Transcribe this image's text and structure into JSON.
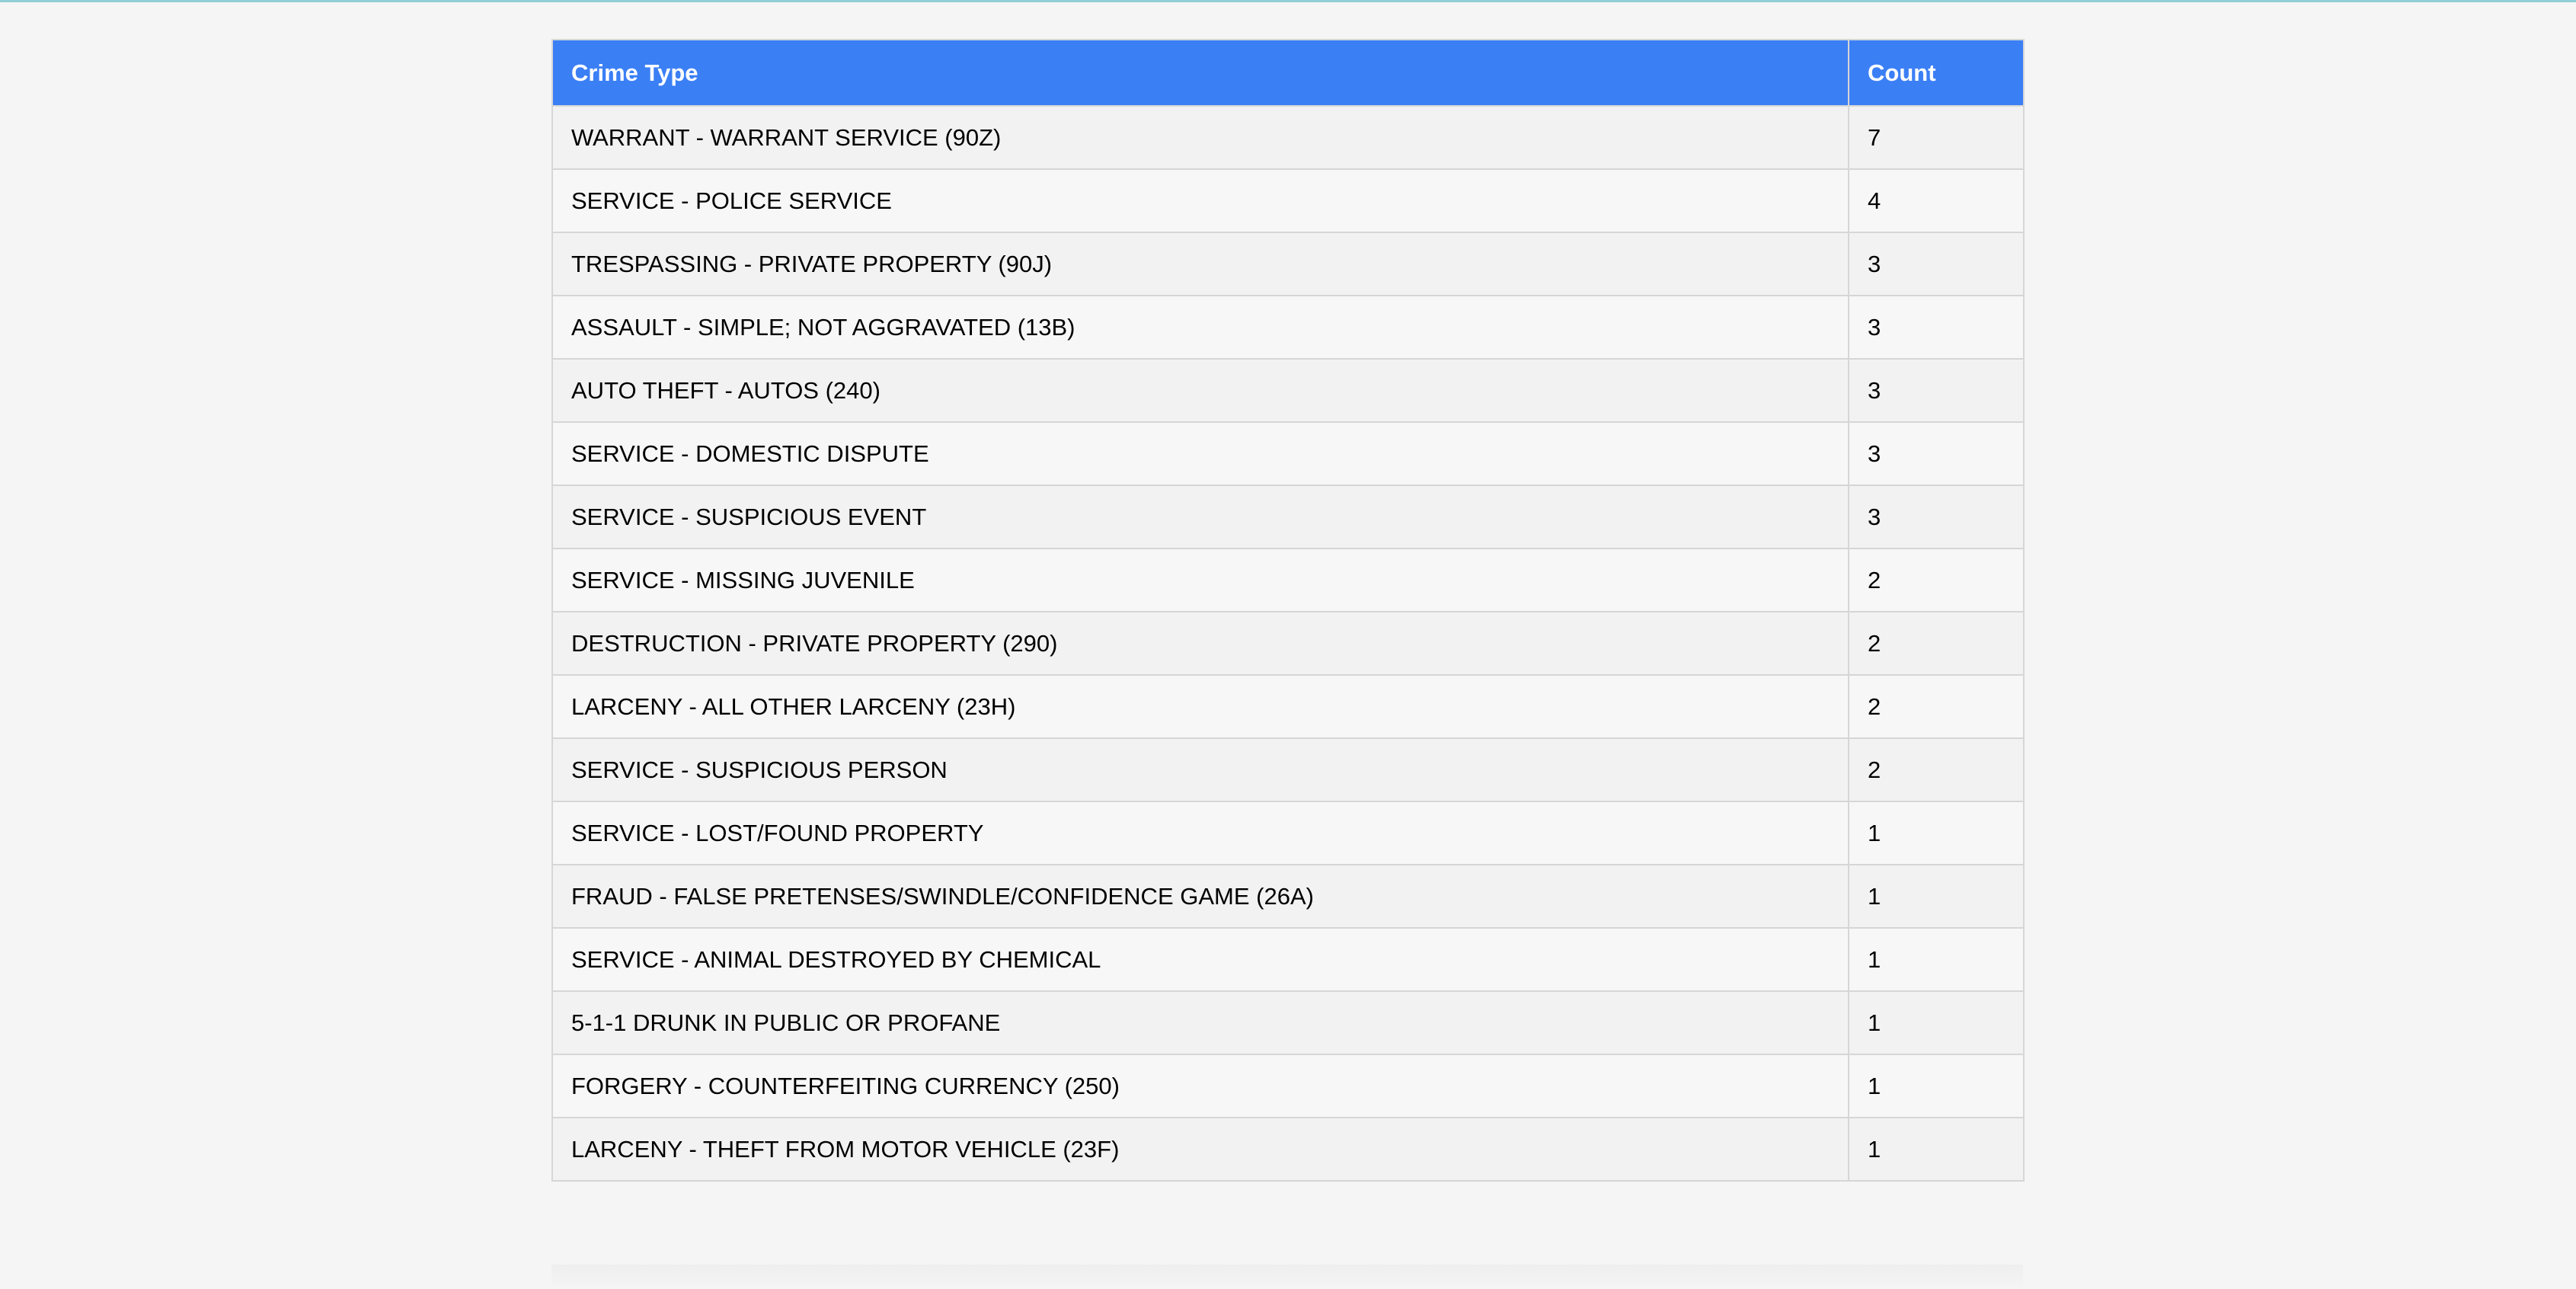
{
  "table": {
    "headers": {
      "crime_type": "Crime Type",
      "count": "Count"
    },
    "rows": [
      {
        "crime_type": "WARRANT - WARRANT SERVICE (90Z)",
        "count": "7"
      },
      {
        "crime_type": "SERVICE - POLICE SERVICE",
        "count": "4"
      },
      {
        "crime_type": "TRESPASSING - PRIVATE PROPERTY (90J)",
        "count": "3"
      },
      {
        "crime_type": "ASSAULT - SIMPLE; NOT AGGRAVATED (13B)",
        "count": "3"
      },
      {
        "crime_type": "AUTO THEFT - AUTOS (240)",
        "count": "3"
      },
      {
        "crime_type": "SERVICE - DOMESTIC DISPUTE",
        "count": "3"
      },
      {
        "crime_type": "SERVICE - SUSPICIOUS EVENT",
        "count": "3"
      },
      {
        "crime_type": "SERVICE - MISSING JUVENILE",
        "count": "2"
      },
      {
        "crime_type": "DESTRUCTION - PRIVATE PROPERTY (290)",
        "count": "2"
      },
      {
        "crime_type": "LARCENY - ALL OTHER LARCENY (23H)",
        "count": "2"
      },
      {
        "crime_type": "SERVICE - SUSPICIOUS PERSON",
        "count": "2"
      },
      {
        "crime_type": "SERVICE - LOST/FOUND PROPERTY",
        "count": "1"
      },
      {
        "crime_type": "FRAUD - FALSE PRETENSES/SWINDLE/CONFIDENCE GAME (26A)",
        "count": "1"
      },
      {
        "crime_type": "SERVICE - ANIMAL DESTROYED BY CHEMICAL",
        "count": "1"
      },
      {
        "crime_type": "5-1-1 DRUNK IN PUBLIC OR PROFANE",
        "count": "1"
      },
      {
        "crime_type": "FORGERY - COUNTERFEITING CURRENCY (250)",
        "count": "1"
      },
      {
        "crime_type": "LARCENY - THEFT FROM MOTOR VEHICLE (23F)",
        "count": "1"
      }
    ]
  },
  "colors": {
    "header_bg": "#3b7ff5",
    "header_text": "#ffffff",
    "row_odd": "#f2f2f2",
    "row_even": "#f7f7f7",
    "border": "#d6d6d6",
    "page_bg": "#f5f5f5"
  }
}
